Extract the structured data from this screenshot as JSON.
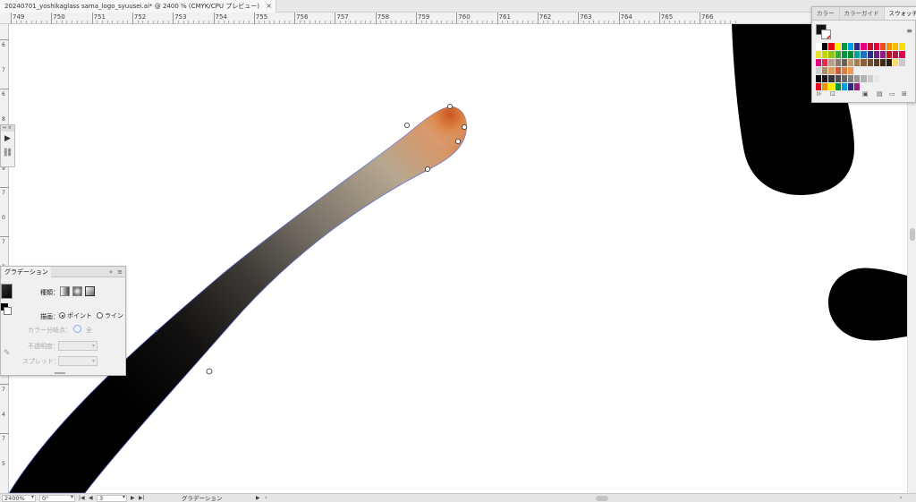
{
  "document": {
    "tab_title": "20240701_yoshikaglass sama_logo_syuusei.ai* @ 2400 % (CMYK/CPU プレビュー)",
    "close_glyph": "×"
  },
  "ruler": {
    "h_labels": [
      "749",
      "750",
      "751",
      "752",
      "753",
      "754",
      "755",
      "756",
      "757",
      "758",
      "759",
      "760",
      "761",
      "762",
      "763",
      "764",
      "765",
      "766"
    ],
    "v_labels": [
      "6",
      "7",
      "6",
      "8",
      "6",
      "9",
      "7",
      "0",
      "7",
      "1",
      "7",
      "2",
      "7",
      "3",
      "7",
      "4",
      "7",
      "5"
    ]
  },
  "swatches_panel": {
    "tabs": [
      {
        "label": "カラー",
        "active": false
      },
      {
        "label": "カラーガイド",
        "active": false
      },
      {
        "label": "スウォッチ",
        "active": true
      }
    ],
    "menu_icon": "hamburger-icon",
    "rows": [
      [
        "#ffffff",
        "#000000",
        "#e30613",
        "#ffed00",
        "#009640",
        "#009fe3",
        "#312783",
        "#e5007e",
        "#c8102e",
        "#e4003a",
        "#e94e1b",
        "#f39200",
        "#fbba00",
        "#ffdd00"
      ],
      [
        "#e6e12d",
        "#c4d600",
        "#95c11f",
        "#3aaa35",
        "#00963f",
        "#008d36",
        "#00a19a",
        "#1d71b8",
        "#2d2e83",
        "#662482",
        "#951b81",
        "#be1622",
        "#a81d45",
        "#e50051"
      ],
      [
        "#e6007e",
        "#e52b50",
        "#b5a190",
        "#8e7a6b",
        "#6b5e52",
        "#c39a6b",
        "#a67c52",
        "#8b5e3c",
        "#6f4e37",
        "#5c3a21",
        "#3f2a1a",
        "#2b1c10",
        "#ffd966",
        "#c9c9c9"
      ],
      [
        "#cfcfcf",
        "#a8906f",
        "#d9a066",
        "#cf5b3a",
        "#e07a3e",
        "#ef9b50"
      ],
      [
        "#000000",
        "#1a1a1a",
        "#333333",
        "#4d4d4d",
        "#666666",
        "#808080",
        "#999999",
        "#b3b3b3",
        "#cccccc",
        "#e6e6e6",
        "#f2f2f2"
      ],
      [
        "#e30613",
        "#f39200",
        "#ffed00",
        "#009640",
        "#009fe3",
        "#312783",
        "#951b81"
      ]
    ]
  },
  "gradient_panel": {
    "title": "グラデーション",
    "collapse_glyph": "«",
    "menu_glyph": "≡",
    "type_label": "種類：",
    "draw_label": "描画：",
    "point_label": "ポイント",
    "line_label": "ライン",
    "color_stop_label": "カラー分岐点：",
    "spread_all_label": "全",
    "opacity_label": "不透明度：",
    "spread_label": "スプレッド："
  },
  "status_bar": {
    "zoom": "2400%",
    "rotation": "0°",
    "artboard": "3",
    "tool_label": "グラデーション"
  },
  "colors": {
    "accent": "#4a6ef5",
    "stroke_tip": "#d8682e",
    "stroke_dark": "#000000"
  }
}
